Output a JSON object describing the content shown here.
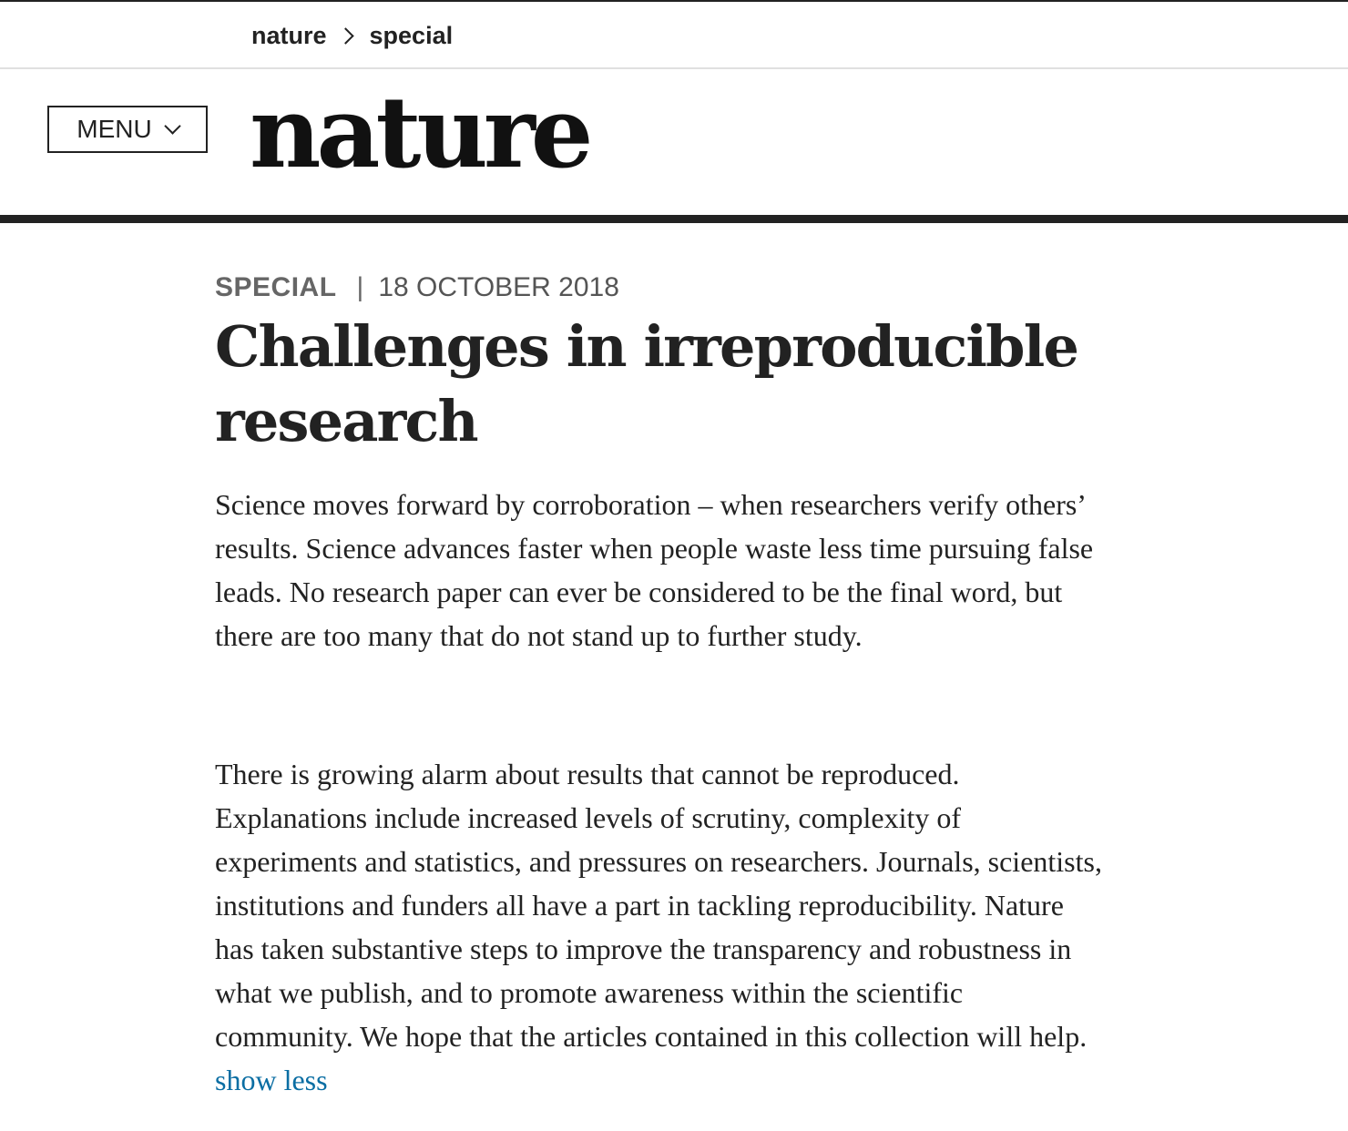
{
  "breadcrumb": {
    "items": [
      "nature",
      "special"
    ]
  },
  "header": {
    "menu_label": "MENU",
    "logo_text": "nature"
  },
  "article": {
    "type": "SPECIAL",
    "separator": "|",
    "date": "18 OCTOBER 2018",
    "title": "Challenges in irreproducible research",
    "paragraphs": [
      "Science moves forward by corroboration – when researchers verify others’ results. Science advances faster when people waste less time pursuing false leads. No research paper can ever be considered to be the final word, but there are too many that do not stand up to further study.",
      "There is growing alarm about results that cannot be reproduced. Explanations include increased levels of scrutiny, complexity of experiments and statistics, and pressures on researchers. Journals, scientists, institutions and funders all have a part in tackling reproducibility. Nature has taken substantive steps to improve the transparency and robustness in what we publish, and to promote awareness within the scientific community. We hope that the articles contained in this collection will help."
    ],
    "toggle_label": "show less"
  },
  "colors": {
    "link": "#0b6ea3",
    "text": "#222222",
    "meta": "#555555"
  }
}
